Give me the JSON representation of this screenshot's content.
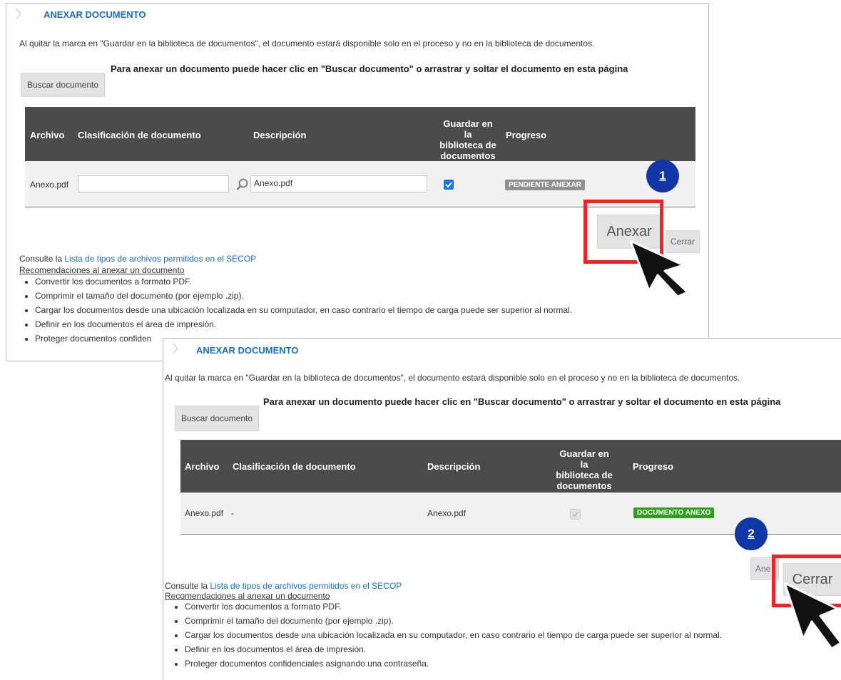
{
  "panel1": {
    "title": "ANEXAR DOCUMENTO",
    "notice": "Al quitar la marca en \"Guardar en la biblioteca de documentos\", el documento estará disponible solo en el proceso y no en la biblioteca de documentos.",
    "instruction": "Para anexar un documento puede hacer clic en \"Buscar documento\" o arrastrar y soltar el documento en esta página",
    "search_button": "Buscar documento",
    "columns": {
      "archivo": "Archivo",
      "clasificacion": "Clasificación de documento",
      "descripcion": "Descripción",
      "guardar_1": "Guardar en la",
      "guardar_2": "biblioteca de",
      "guardar_3": "documentos",
      "progreso": "Progreso"
    },
    "row": {
      "archivo": "Anexo.pdf",
      "clasificacion_value": "",
      "descripcion_value": "Anexo.pdf",
      "guardar_checked": true,
      "status": "PENDIENTE ANEXAR",
      "status_color": "#8f8f8f"
    },
    "anexar_button": "Anexar",
    "cerrar_button": "Cerrar",
    "consult_prefix": "Consulte la ",
    "consult_link": "Lista de tipos de archivos permitidos en el SECOP",
    "recommendations_title": "Recomendaciones al anexar un documento",
    "recommendations": [
      "Convertir los documentos a formato PDF.",
      "Comprimir el tamaño del documento (por ejemplo .zip).",
      "Cargar los documentos desde una ubicación localizada en su computador, en caso contrario el tiempo de carga puede ser superior al normal.",
      "Definir en los documentos el área de impresión.",
      "Proteger documentos confiden"
    ]
  },
  "panel2": {
    "title": "ANEXAR DOCUMENTO",
    "notice": "Al quitar la marca en \"Guardar en la biblioteca de documentos\", el documento estará disponible solo en el proceso y no en la biblioteca de documentos.",
    "instruction": "Para anexar un documento puede hacer clic en \"Buscar documento\" o arrastrar y soltar el documento en esta página",
    "search_button": "Buscar documento",
    "columns": {
      "archivo": "Archivo",
      "clasificacion": "Clasificación de documento",
      "descripcion": "Descripción",
      "guardar_1": "Guardar en la",
      "guardar_2": "biblioteca de",
      "guardar_3": "documentos",
      "progreso": "Progreso"
    },
    "row": {
      "archivo": "Anexo.pdf",
      "clasificacion": "-",
      "descripcion": "Anexo.pdf",
      "guardar_checked": true,
      "status": "DOCUMENTO ANEXO",
      "status_color": "#2f9e1f"
    },
    "anexar_button_partial": "Ane",
    "cerrar_button": "Cerrar",
    "consult_prefix": "Consulte la ",
    "consult_link": "Lista de tipos de archivos permitidos en el SECOP",
    "recommendations_title": "Recomendaciones al anexar un documento",
    "recommendations": [
      "Convertir los documentos a formato PDF.",
      "Comprimir el tamaño del documento (por ejemplo .zip).",
      "Cargar los documentos desde una ubicación localizada en su computador, en caso contrario el tiempo de carga puede ser superior al normal.",
      "Definir en los documentos el área de impresión.",
      "Proteger documentos confidenciales asignando una contraseña."
    ]
  },
  "markers": {
    "step1": "1",
    "step2": "2",
    "highlight_color": "#ff1f1f",
    "marker_color": "#1136a8"
  }
}
